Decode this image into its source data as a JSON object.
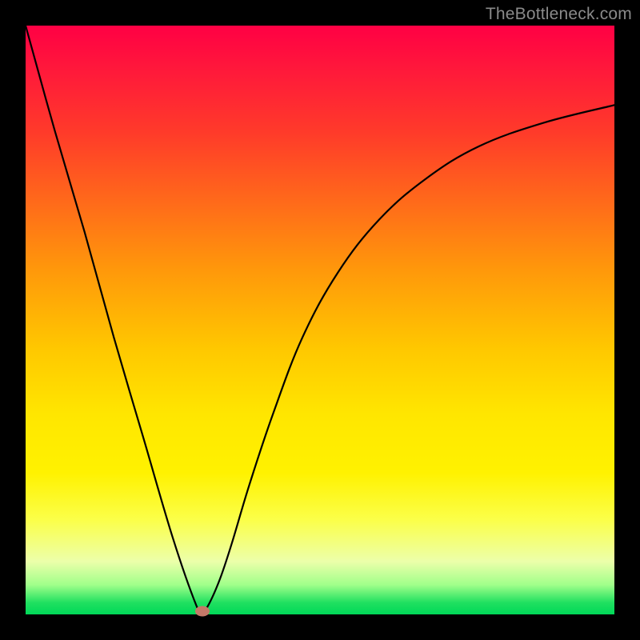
{
  "watermark": "TheBottleneck.com",
  "chart_data": {
    "type": "line",
    "title": "",
    "xlabel": "",
    "ylabel": "",
    "xlim": [
      0,
      100
    ],
    "ylim": [
      0,
      100
    ],
    "grid": false,
    "legend": false,
    "series": [
      {
        "name": "bottleneck-curve",
        "x": [
          0,
          5,
          10,
          15,
          20,
          25,
          29,
          30,
          31,
          33,
          35,
          38,
          42,
          47,
          53,
          60,
          68,
          77,
          88,
          100
        ],
        "y": [
          100,
          82,
          65,
          47,
          30,
          13,
          1.5,
          0.5,
          1.5,
          6,
          12,
          22,
          34,
          47,
          58,
          67,
          74,
          79.5,
          83.5,
          86.5
        ]
      }
    ],
    "marker": {
      "x": 30,
      "y": 0.5,
      "color": "#c47868"
    },
    "background_gradient": {
      "top": "#ff0044",
      "mid": "#ffe600",
      "bottom": "#00d858"
    },
    "frame_color": "#000000",
    "curve_color": "#000000"
  }
}
